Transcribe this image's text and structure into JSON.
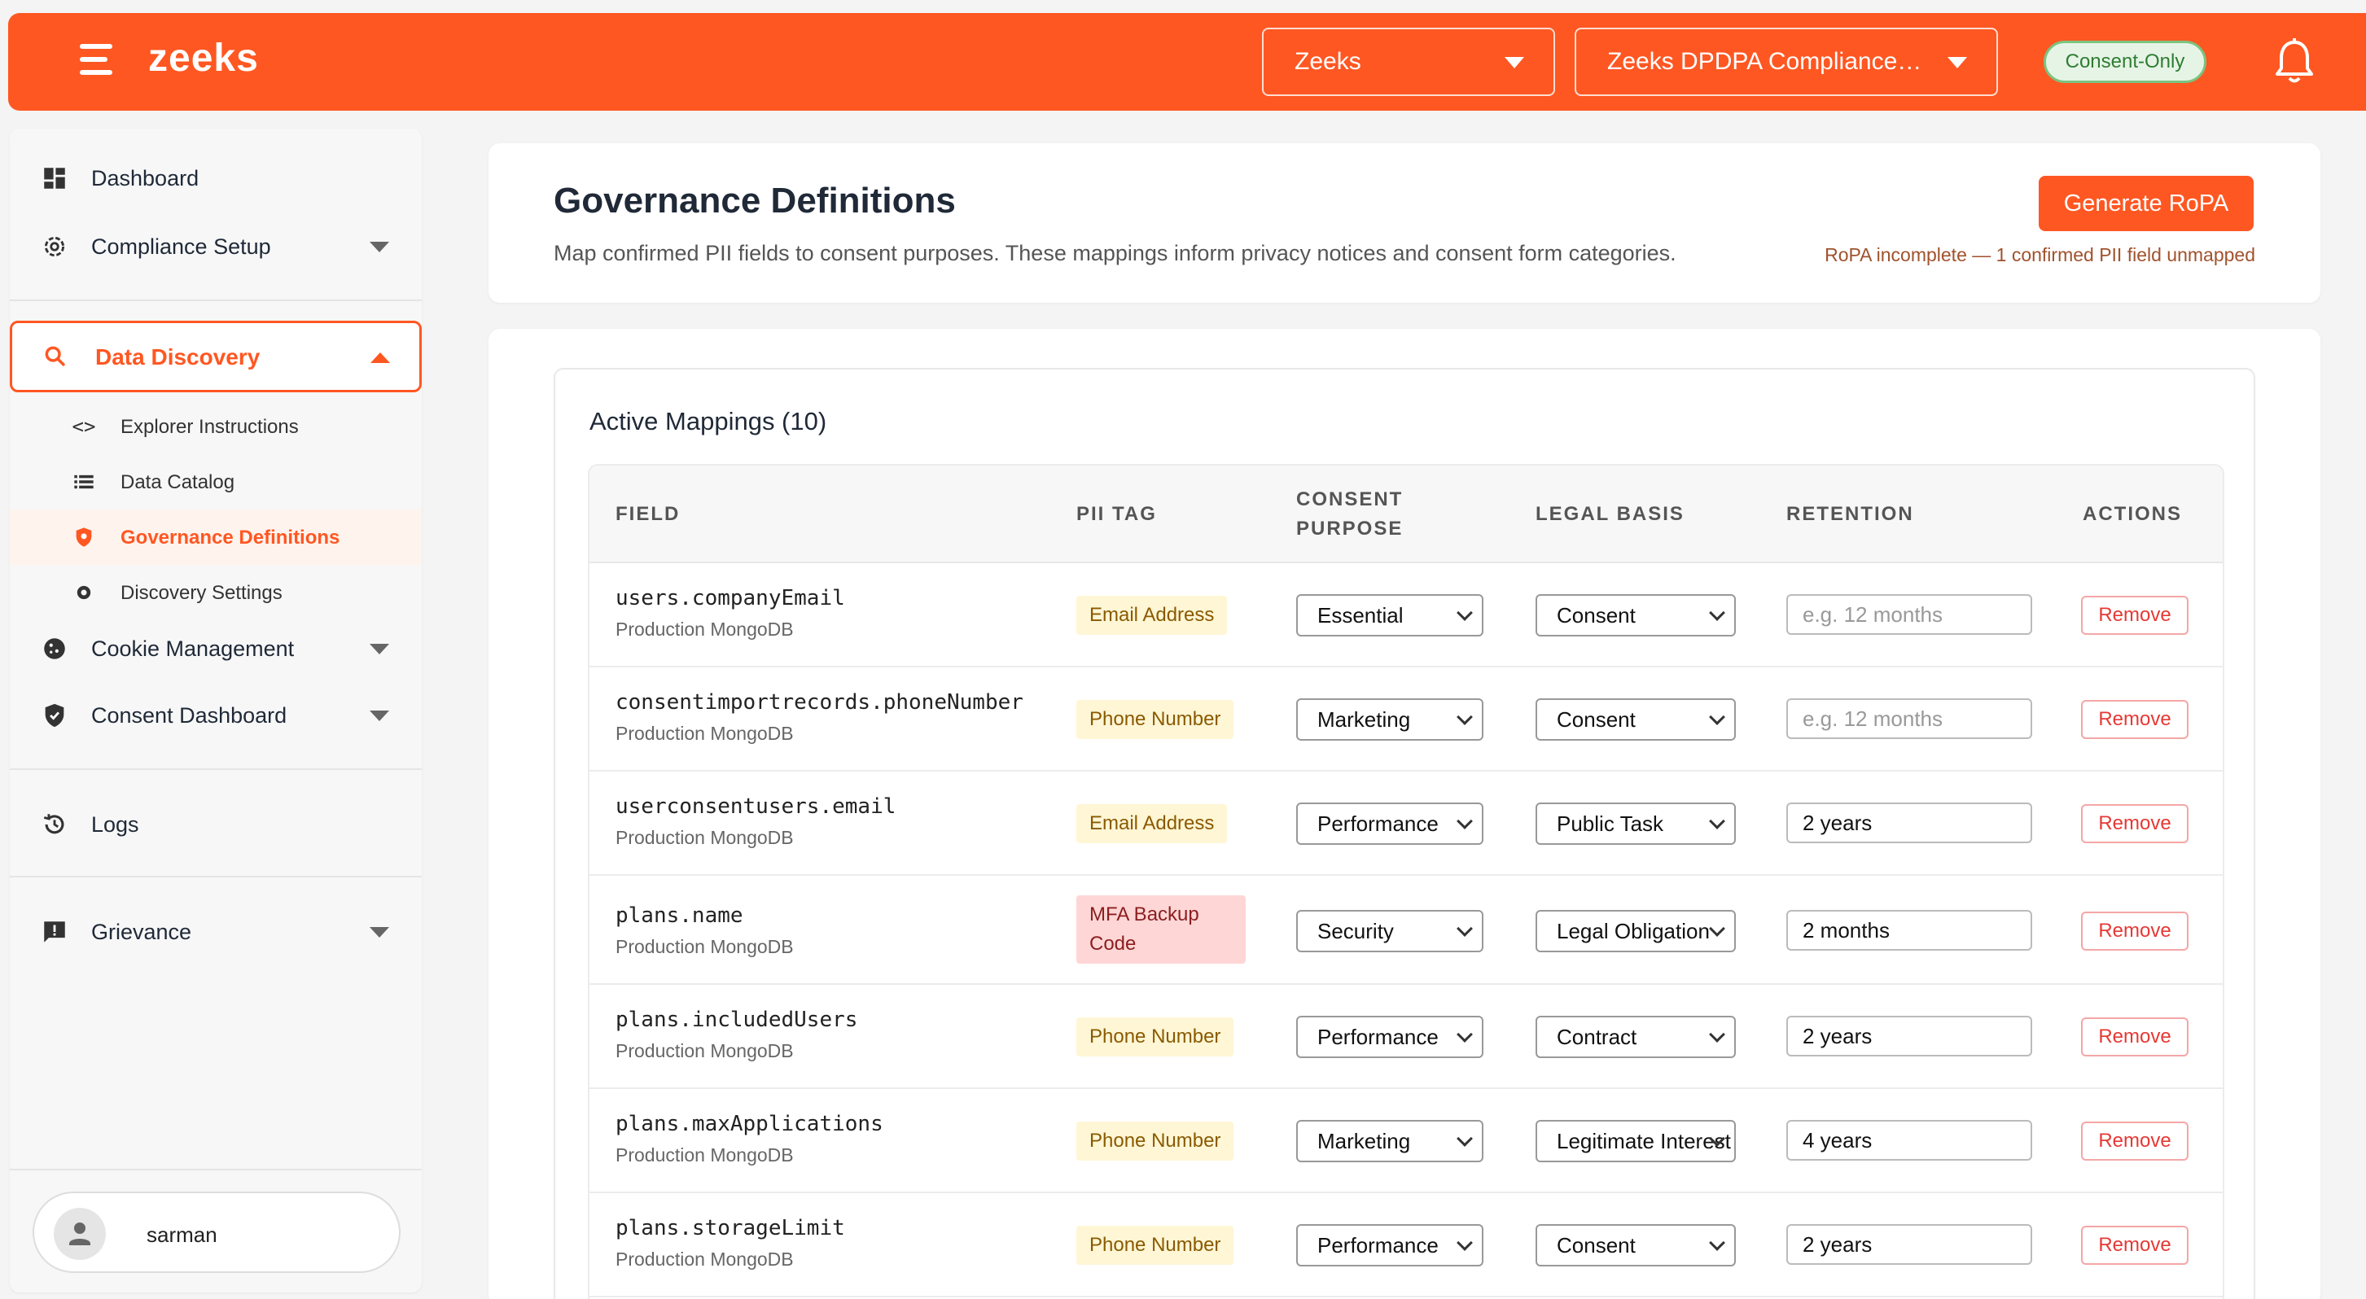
{
  "topbar": {
    "brand": "zeeks",
    "org_select": "Zeeks",
    "project_select": "Zeeks DPDPA Compliance C...",
    "mode_badge": "Consent-Only",
    "accent": "#ff5722"
  },
  "sidebar": {
    "dashboard": "Dashboard",
    "compliance_setup": "Compliance Setup",
    "data_discovery": "Data Discovery",
    "sub": {
      "explorer": "Explorer Instructions",
      "catalog": "Data Catalog",
      "governance": "Governance Definitions",
      "settings": "Discovery Settings"
    },
    "cookie": "Cookie Management",
    "consent_dashboard": "Consent Dashboard",
    "logs": "Logs",
    "grievance": "Grievance",
    "user": "sarman"
  },
  "header": {
    "title": "Governance Definitions",
    "subtitle": "Map confirmed PII fields to consent purposes. These mappings inform privacy notices and consent form categories.",
    "generate_label": "Generate RoPA",
    "warning": "RoPA incomplete — 1 confirmed PII field unmapped"
  },
  "mappings": {
    "title": "Active Mappings (10)",
    "columns": {
      "field": "FIELD",
      "pii": "PII TAG",
      "purpose_1": "CONSENT",
      "purpose_2": "PURPOSE",
      "basis": "LEGAL BASIS",
      "retention": "RETENTION",
      "actions": "ACTIONS"
    },
    "retention_placeholder": "e.g. 12 months",
    "remove_label": "Remove",
    "rows": [
      {
        "field": "users.companyEmail",
        "source": "Production MongoDB",
        "pii": "Email Address",
        "purpose": "Essential",
        "basis": "Consent",
        "retention": ""
      },
      {
        "field": "consentimportrecords.phoneNumber",
        "source": "Production MongoDB",
        "pii": "Phone Number",
        "purpose": "Marketing",
        "basis": "Consent",
        "retention": ""
      },
      {
        "field": "userconsentusers.email",
        "source": "Production MongoDB",
        "pii": "Email Address",
        "purpose": "Performance",
        "basis": "Public Task",
        "retention": "2 years"
      },
      {
        "field": "plans.name",
        "source": "Production MongoDB",
        "pii_line1": "MFA Backup",
        "pii_line2": "Code",
        "purpose": "Security",
        "basis": "Legal Obligation",
        "retention": "2 months"
      },
      {
        "field": "plans.includedUsers",
        "source": "Production MongoDB",
        "pii": "Phone Number",
        "purpose": "Performance",
        "basis": "Contract",
        "retention": "2 years"
      },
      {
        "field": "plans.maxApplications",
        "source": "Production MongoDB",
        "pii": "Phone Number",
        "purpose": "Marketing",
        "basis": "Legitimate Interest",
        "retention": "4 years"
      },
      {
        "field": "plans.storageLimit",
        "source": "Production MongoDB",
        "pii": "Phone Number",
        "purpose": "Performance",
        "basis": "Consent",
        "retention": "2 years"
      }
    ]
  }
}
